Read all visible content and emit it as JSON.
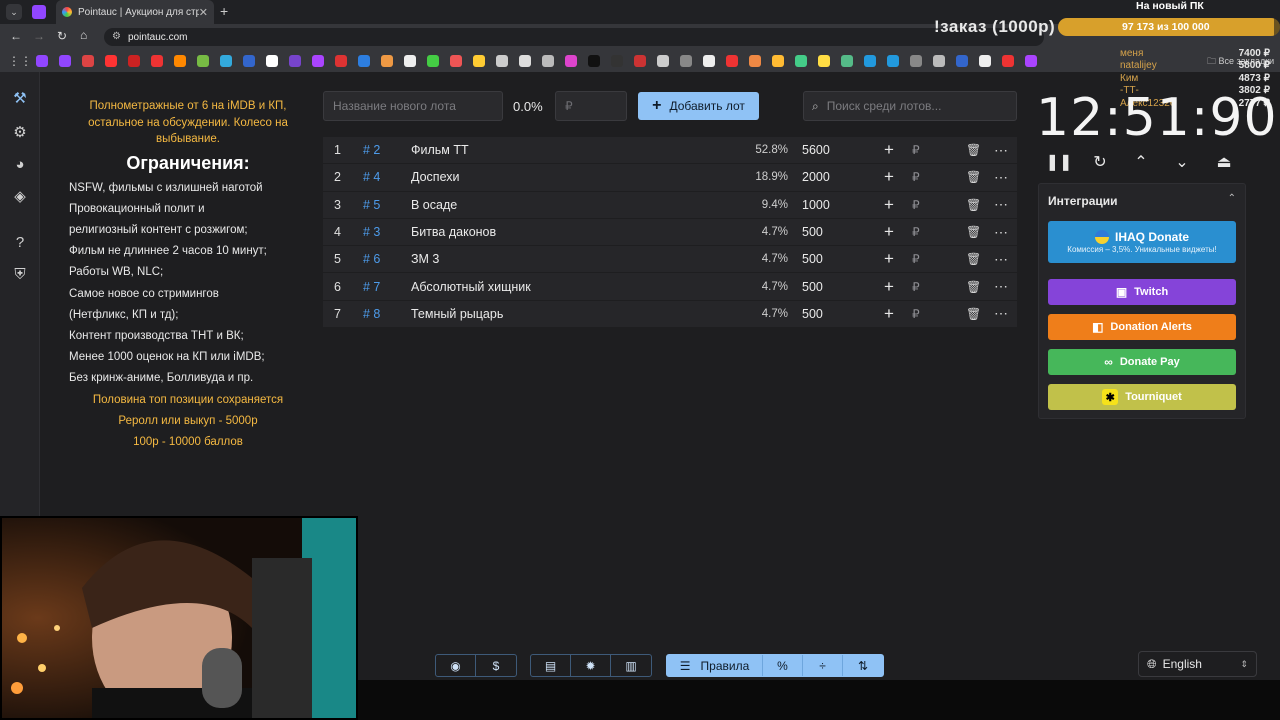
{
  "browser": {
    "tab_title": "Pointauc | Аукцион для стримеров",
    "url": "pointauc.com",
    "all_bookmarks_label": "Все закладки"
  },
  "overlay": {
    "title": "На новый ПК",
    "order_command": "!заказ (1000р)",
    "progress_text": "97 173  из 100 000",
    "progress_fraction": 0.972,
    "donors": [
      {
        "name": "меня",
        "amount": "7400 ₽"
      },
      {
        "name": "natalijey",
        "amount": "5800 ₽"
      },
      {
        "name": "Ким",
        "amount": "4873 ₽"
      },
      {
        "name": "-ТТ-",
        "amount": "3802 ₽"
      },
      {
        "name": "Алекс12326",
        "amount": "2777 ₽"
      }
    ]
  },
  "rules": {
    "intro": "Полнометражные от 6 на iMDB и КП, остальное на обсуждении. Колесо на выбывание.",
    "title": "Ограничения:",
    "lines": [
      "NSFW, фильмы с излишней наготой",
      "Провокационный полит и",
      "религиозный контент с розжигом;",
      "Фильм не длиннее 2 часов 10 минут;",
      "Работы WB, NLC;",
      "Самое новое со стримингов",
      "(Нетфликс, КП и тд);",
      "Контент производства ТНТ и ВК;",
      "Менее 1000 оценок на КП или iMDB;",
      "Без кринж-аниме, Болливуда и пр."
    ],
    "footer": [
      "Половина топ позиции сохраняется",
      "Реролл или выкуп - 5000р",
      "100р - 10000 баллов"
    ]
  },
  "toolbar": {
    "lot_placeholder": "Название нового лота",
    "percent": "0.0%",
    "amount_placeholder": "₽",
    "add_label": "Добавить лот",
    "search_placeholder": "Поиск среди лотов..."
  },
  "lots": [
    {
      "num": "1",
      "id": "# 2",
      "name": "Фильм ТТ",
      "percent": "52.8%",
      "amount": "5600"
    },
    {
      "num": "2",
      "id": "# 4",
      "name": "Доспехи",
      "percent": "18.9%",
      "amount": "2000"
    },
    {
      "num": "3",
      "id": "# 5",
      "name": "В осаде",
      "percent": "9.4%",
      "amount": "1000"
    },
    {
      "num": "4",
      "id": "# 3",
      "name": "Битва даконов",
      "percent": "4.7%",
      "amount": "500"
    },
    {
      "num": "5",
      "id": "# 6",
      "name": "ЗМ 3",
      "percent": "4.7%",
      "amount": "500"
    },
    {
      "num": "6",
      "id": "# 7",
      "name": "Абсолютный хищник",
      "percent": "4.7%",
      "amount": "500"
    },
    {
      "num": "7",
      "id": "# 8",
      "name": "Темный рыцарь",
      "percent": "4.7%",
      "amount": "500"
    }
  ],
  "row_symbols": {
    "plus": "+",
    "currency": "₽"
  },
  "timer": {
    "value": "12:51:90"
  },
  "integrations": {
    "title": "Интеграции",
    "ihaq_label": "IHAQ Donate",
    "ihaq_sub": "Комиссия – 3,5%. Уникальные виджеты!",
    "twitch": "Twitch",
    "donation_alerts": "Donation Alerts",
    "donate_pay": "Donate Pay",
    "tourniquet": "Tourniquet"
  },
  "bottom": {
    "rules_label": "Правила",
    "language": "English"
  }
}
